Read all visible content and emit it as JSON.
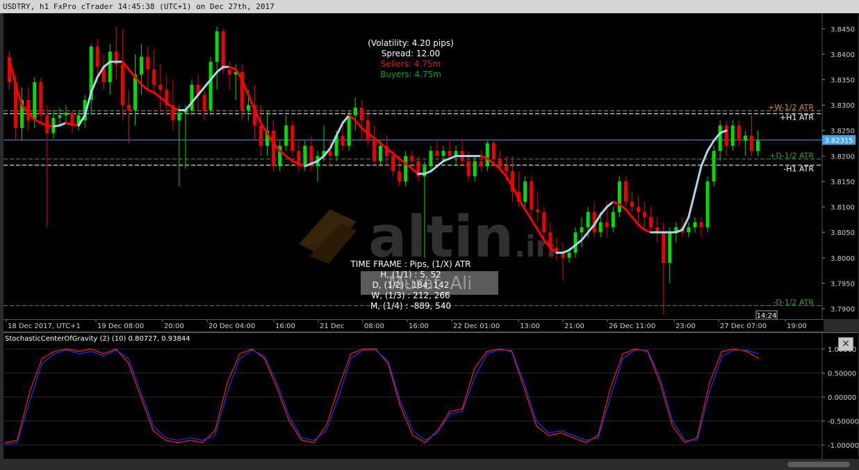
{
  "window": {
    "title": "USDTRY, h1 FxPro cTrader 14:45:38 (UTC+1) on Dec 27th, 2017"
  },
  "info_box": {
    "volatility": "(Volatility: 4.20 pips)",
    "spread": "Spread: 12.00",
    "sellers": "Sellers: 4.75m",
    "buyers": "Buyers: 4.75m"
  },
  "watermark": {
    "brand": "altin",
    "suffix": ".in"
  },
  "timeframe_table": {
    "header": "TIME FRAME   : Pips, (1/X) ATR",
    "row_h": "H, (1/1) :   5,   52",
    "row_d": "D, (1/2) : 184,  142",
    "row_w": "W, (1/3) : 212,  266",
    "row_m": "M, (1/4) : -889,  540",
    "overlay_name": "Murat_Ali"
  },
  "levels": {
    "w_half_atr": "+W-1/2 ATR",
    "h1_atr_plus": "+H1 ATR",
    "d_half_atr_plus": "+D-1/2 ATR",
    "h1_atr_minus": "-H1 ATR",
    "d_half_atr_minus": "-D-1/2 ATR"
  },
  "current_price": "3.82315",
  "current_time": "14:24",
  "indicator": {
    "label": "StochasticCenterOfGravity (2) (10) 0.80727, 0.93844",
    "close_symbol": "✕"
  },
  "colors": {
    "up": "#00dd00",
    "down": "#ee0000",
    "ma_down": "#ff0000",
    "ma_up": "#a8d8f0",
    "ind_red": "#ff2200",
    "ind_blue": "#2233ff",
    "price_line": "#4aa3df"
  },
  "chart_data": [
    {
      "type": "candlestick",
      "symbol": "USDTRY",
      "timeframe": "h1",
      "x_tick_labels": [
        "18 Dec 2017, UTC+1",
        "19 Dec 08:00",
        "20:00",
        "20 Dec 04:00",
        "16:00",
        "21 Dec",
        "08:00",
        "16:00",
        "22 Dec 01:00",
        "13:00",
        "21:00",
        "26 Dec 11:00",
        "23:00",
        "27 Dec 07:00",
        "19:00"
      ],
      "y_tick_labels": [
        "3.8450",
        "3.8400",
        "3.8350",
        "3.8300",
        "3.8250",
        "3.8200",
        "3.8150",
        "3.8100",
        "3.8050",
        "3.8000",
        "3.7950",
        "3.7900"
      ],
      "ylim": [
        3.7885,
        3.8475
      ],
      "levels": [
        {
          "name": "+W-1/2 ATR",
          "value": 3.8289,
          "color": "#d08a50",
          "style": "dashed"
        },
        {
          "name": "+H1 ATR",
          "value": 3.8283,
          "color": "#ffffff",
          "style": "dashed"
        },
        {
          "name": "+D-1/2 ATR",
          "value": 3.8194,
          "color": "#3aa04a",
          "style": "dashed"
        },
        {
          "name": "-H1 ATR",
          "value": 3.8182,
          "color": "#ffffff",
          "style": "dashed"
        },
        {
          "name": "-D-1/2 ATR",
          "value": 3.7906,
          "color": "#3aa04a",
          "style": "dashed"
        },
        {
          "name": "price",
          "value": 3.82315,
          "color": "#4aa3df",
          "style": "solid"
        }
      ],
      "candles": [
        [
          3.8395,
          3.8405,
          3.833,
          3.8345
        ],
        [
          3.8345,
          3.836,
          3.823,
          3.8255
        ],
        [
          3.8255,
          3.8335,
          3.823,
          3.831
        ],
        [
          3.831,
          3.8335,
          3.825,
          3.827
        ],
        [
          3.827,
          3.8355,
          3.8255,
          3.8345
        ],
        [
          3.8345,
          3.8355,
          3.8265,
          3.828
        ],
        [
          3.828,
          3.83,
          3.806,
          3.8245
        ],
        [
          3.8245,
          3.829,
          3.8235,
          3.8275
        ],
        [
          3.8275,
          3.8295,
          3.826,
          3.828
        ],
        [
          3.828,
          3.83,
          3.8265,
          3.8285
        ],
        [
          3.8285,
          3.829,
          3.8245,
          3.826
        ],
        [
          3.826,
          3.829,
          3.825,
          3.828
        ],
        [
          3.827,
          3.832,
          3.8255,
          3.831
        ],
        [
          3.831,
          3.842,
          3.828,
          3.8415
        ],
        [
          3.8415,
          3.843,
          3.834,
          3.8375
        ],
        [
          3.8375,
          3.84,
          3.833,
          3.8345
        ],
        [
          3.8345,
          3.842,
          3.832,
          3.8405
        ],
        [
          3.8405,
          3.8455,
          3.835,
          3.838
        ],
        [
          3.838,
          3.845,
          3.827,
          3.83
        ],
        [
          3.83,
          3.833,
          3.8225,
          3.829
        ],
        [
          3.829,
          3.84,
          3.826,
          3.836
        ],
        [
          3.836,
          3.842,
          3.832,
          3.8395
        ],
        [
          3.8395,
          3.8415,
          3.833,
          3.837
        ],
        [
          3.837,
          3.841,
          3.832,
          3.834
        ],
        [
          3.834,
          3.838,
          3.829,
          3.833
        ],
        [
          3.833,
          3.836,
          3.828,
          3.83
        ],
        [
          3.83,
          3.835,
          3.825,
          3.827
        ],
        [
          3.827,
          3.83,
          3.814,
          3.8285
        ],
        [
          3.8285,
          3.83,
          3.8175,
          3.829
        ],
        [
          3.829,
          3.835,
          3.828,
          3.834
        ],
        [
          3.834,
          3.836,
          3.829,
          3.832
        ],
        [
          3.832,
          3.833,
          3.827,
          3.829
        ],
        [
          3.829,
          3.8395,
          3.828,
          3.8385
        ],
        [
          3.8385,
          3.8455,
          3.833,
          3.8445
        ],
        [
          3.8445,
          3.845,
          3.836,
          3.837
        ],
        [
          3.837,
          3.8385,
          3.833,
          3.836
        ],
        [
          3.836,
          3.838,
          3.831,
          3.8365
        ],
        [
          3.8365,
          3.838,
          3.827,
          3.829
        ],
        [
          3.829,
          3.833,
          3.827,
          3.83
        ],
        [
          3.83,
          3.834,
          3.823,
          3.826
        ],
        [
          3.826,
          3.83,
          3.82,
          3.822
        ],
        [
          3.822,
          3.829,
          3.82,
          3.825
        ],
        [
          3.825,
          3.827,
          3.817,
          3.818
        ],
        [
          3.818,
          3.823,
          3.817,
          3.822
        ],
        [
          3.822,
          3.828,
          3.821,
          3.826
        ],
        [
          3.826,
          3.827,
          3.82,
          3.821
        ],
        [
          3.821,
          3.823,
          3.817,
          3.818
        ],
        [
          3.818,
          3.823,
          3.817,
          3.822
        ],
        [
          3.822,
          3.824,
          3.817,
          3.818
        ],
        [
          3.818,
          3.821,
          3.815,
          3.82
        ],
        [
          3.82,
          3.826,
          3.819,
          3.821
        ],
        [
          3.821,
          3.823,
          3.818,
          3.82
        ],
        [
          3.82,
          3.825,
          3.819,
          3.824
        ],
        [
          3.824,
          3.827,
          3.821,
          3.822
        ],
        [
          3.822,
          3.829,
          3.821,
          3.828
        ],
        [
          3.828,
          3.8315,
          3.825,
          3.8295
        ],
        [
          3.8295,
          3.831,
          3.823,
          3.827
        ],
        [
          3.827,
          3.829,
          3.822,
          3.823
        ],
        [
          3.823,
          3.826,
          3.818,
          3.819
        ],
        [
          3.819,
          3.823,
          3.818,
          3.822
        ],
        [
          3.822,
          3.824,
          3.818,
          3.82
        ],
        [
          3.82,
          3.821,
          3.816,
          3.817
        ],
        [
          3.817,
          3.82,
          3.814,
          3.815
        ],
        [
          3.815,
          3.821,
          3.814,
          3.82
        ],
        [
          3.82,
          3.821,
          3.817,
          3.819
        ],
        [
          3.819,
          3.82,
          3.815,
          3.816
        ],
        [
          3.816,
          3.819,
          3.8,
          3.818
        ],
        [
          3.818,
          3.822,
          3.817,
          3.821
        ],
        [
          3.821,
          3.823,
          3.818,
          3.82
        ],
        [
          3.82,
          3.822,
          3.819,
          3.821
        ],
        [
          3.821,
          3.823,
          3.819,
          3.82
        ],
        [
          3.82,
          3.822,
          3.818,
          3.821
        ],
        [
          3.821,
          3.8235,
          3.818,
          3.819
        ],
        [
          3.819,
          3.821,
          3.815,
          3.816
        ],
        [
          3.816,
          3.82,
          3.815,
          3.819
        ],
        [
          3.819,
          3.821,
          3.817,
          3.818
        ],
        [
          3.818,
          3.823,
          3.817,
          3.8225
        ],
        [
          3.8225,
          3.823,
          3.818,
          3.8195
        ],
        [
          3.8195,
          3.821,
          3.817,
          3.818
        ],
        [
          3.818,
          3.82,
          3.815,
          3.817
        ],
        [
          3.817,
          3.82,
          3.811,
          3.813
        ],
        [
          3.813,
          3.817,
          3.81,
          3.811
        ],
        [
          3.811,
          3.816,
          3.81,
          3.815
        ],
        [
          3.815,
          3.816,
          3.808,
          3.8095
        ],
        [
          3.8095,
          3.813,
          3.807,
          3.809
        ],
        [
          3.809,
          3.81,
          3.803,
          3.805
        ],
        [
          3.805,
          3.807,
          3.8,
          3.802
        ],
        [
          3.802,
          3.804,
          3.7995,
          3.801
        ],
        [
          3.801,
          3.803,
          3.7955,
          3.8
        ],
        [
          3.8,
          3.802,
          3.799,
          3.801
        ],
        [
          3.801,
          3.806,
          3.8,
          3.805
        ],
        [
          3.805,
          3.808,
          3.802,
          3.806
        ],
        [
          3.806,
          3.81,
          3.804,
          3.809
        ],
        [
          3.809,
          3.811,
          3.804,
          3.805
        ],
        [
          3.805,
          3.809,
          3.804,
          3.807
        ],
        [
          3.807,
          3.811,
          3.804,
          3.806
        ],
        [
          3.806,
          3.81,
          3.805,
          3.809
        ],
        [
          3.809,
          3.816,
          3.808,
          3.815
        ],
        [
          3.815,
          3.816,
          3.81,
          3.811
        ],
        [
          3.811,
          3.813,
          3.809,
          3.81
        ],
        [
          3.81,
          3.812,
          3.807,
          3.809
        ],
        [
          3.809,
          3.811,
          3.806,
          3.808
        ],
        [
          3.808,
          3.81,
          3.805,
          3.806
        ],
        [
          3.806,
          3.808,
          3.803,
          3.805
        ],
        [
          3.805,
          3.807,
          3.789,
          3.799
        ],
        [
          3.799,
          3.806,
          3.795,
          3.805
        ],
        [
          3.805,
          3.807,
          3.803,
          3.806
        ],
        [
          3.806,
          3.808,
          3.804,
          3.805
        ],
        [
          3.805,
          3.807,
          3.804,
          3.806
        ],
        [
          3.806,
          3.808,
          3.805,
          3.807
        ],
        [
          3.807,
          3.808,
          3.804,
          3.806
        ],
        [
          3.806,
          3.816,
          3.805,
          3.815
        ],
        [
          3.815,
          3.822,
          3.814,
          3.821
        ],
        [
          3.821,
          3.827,
          3.819,
          3.826
        ],
        [
          3.826,
          3.827,
          3.82,
          3.822
        ],
        [
          3.822,
          3.827,
          3.821,
          3.826
        ],
        [
          3.826,
          3.827,
          3.822,
          3.823
        ],
        [
          3.823,
          3.825,
          3.82,
          3.824
        ],
        [
          3.824,
          3.828,
          3.82,
          3.821
        ],
        [
          3.821,
          3.825,
          3.82,
          3.823
        ]
      ],
      "ma_line": [
        3.839,
        3.834,
        3.83,
        3.8285,
        3.8272,
        3.8265,
        3.826,
        3.8258,
        3.826,
        3.8265,
        3.8262,
        3.826,
        3.828,
        3.8325,
        3.8355,
        3.8375,
        3.8385,
        3.8385,
        3.8385,
        3.837,
        3.8355,
        3.834,
        3.833,
        3.8325,
        3.8315,
        3.8305,
        3.8295,
        3.829,
        3.829,
        3.8305,
        3.832,
        3.8335,
        3.835,
        3.8365,
        3.8375,
        3.8375,
        3.837,
        3.835,
        3.832,
        3.829,
        3.8265,
        3.8245,
        3.8225,
        3.821,
        3.82,
        3.819,
        3.8185,
        3.818,
        3.8185,
        3.819,
        3.82,
        3.8215,
        3.824,
        3.8265,
        3.828,
        3.827,
        3.8255,
        3.8245,
        3.8235,
        3.8225,
        3.8215,
        3.8205,
        3.8195,
        3.8185,
        3.8175,
        3.8165,
        3.8165,
        3.817,
        3.818,
        3.819,
        3.8195,
        3.82,
        3.82,
        3.82,
        3.82,
        3.82,
        3.8195,
        3.8185,
        3.8175,
        3.816,
        3.814,
        3.8115,
        3.8095,
        3.8075,
        3.8055,
        3.8035,
        3.802,
        3.801,
        3.801,
        3.8015,
        3.8025,
        3.8035,
        3.805,
        3.8065,
        3.8085,
        3.81,
        3.811,
        3.8105,
        3.8095,
        3.808,
        3.8065,
        3.8055,
        3.805,
        3.805,
        3.805,
        3.805,
        3.805,
        3.8055,
        3.808,
        3.813,
        3.818,
        3.821,
        3.823,
        3.8245,
        3.825
      ]
    },
    {
      "type": "line",
      "name": "StochasticCenterOfGravity (2) (10)",
      "y_tick_labels": [
        "1.00000",
        "0.50000",
        "0.00000",
        "-0.50000",
        "-1.00000"
      ],
      "ylim": [
        -1.1,
        1.1
      ],
      "series": [
        {
          "color": "#ff2200",
          "values": [
            -0.95,
            -0.9,
            0.1,
            0.8,
            0.95,
            1.0,
            0.95,
            1.0,
            0.9,
            1.0,
            0.7,
            0.0,
            -0.7,
            -0.9,
            -0.95,
            -0.9,
            -0.95,
            -0.7,
            0.3,
            0.9,
            1.0,
            0.8,
            0.2,
            -0.5,
            -0.9,
            -0.95,
            -0.6,
            0.2,
            0.9,
            1.0,
            1.0,
            0.7,
            -0.2,
            -0.8,
            -0.95,
            -0.7,
            -0.3,
            -0.25,
            0.6,
            0.95,
            1.0,
            0.95,
            0.2,
            -0.6,
            -0.8,
            -0.75,
            -0.85,
            -0.95,
            -0.8,
            0.2,
            0.9,
            1.0,
            0.95,
            0.3,
            -0.6,
            -0.95,
            -0.85,
            0.3,
            0.95,
            1.0,
            0.95,
            0.8
          ]
        },
        {
          "color": "#2233ff",
          "values": [
            -0.98,
            -0.95,
            -0.1,
            0.7,
            0.9,
            0.98,
            0.9,
            0.95,
            0.85,
            0.98,
            0.8,
            0.1,
            -0.6,
            -0.85,
            -0.9,
            -0.85,
            -0.9,
            -0.8,
            0.1,
            0.8,
            0.98,
            0.85,
            0.3,
            -0.4,
            -0.85,
            -0.9,
            -0.7,
            0.0,
            0.8,
            0.98,
            0.98,
            0.75,
            -0.1,
            -0.7,
            -0.9,
            -0.75,
            -0.35,
            -0.3,
            0.4,
            0.9,
            0.98,
            0.97,
            0.3,
            -0.5,
            -0.75,
            -0.7,
            -0.8,
            -0.9,
            -0.85,
            0.0,
            0.8,
            0.98,
            0.97,
            0.4,
            -0.5,
            -0.9,
            -0.9,
            0.1,
            0.85,
            0.98,
            0.97,
            0.9
          ]
        }
      ]
    }
  ]
}
